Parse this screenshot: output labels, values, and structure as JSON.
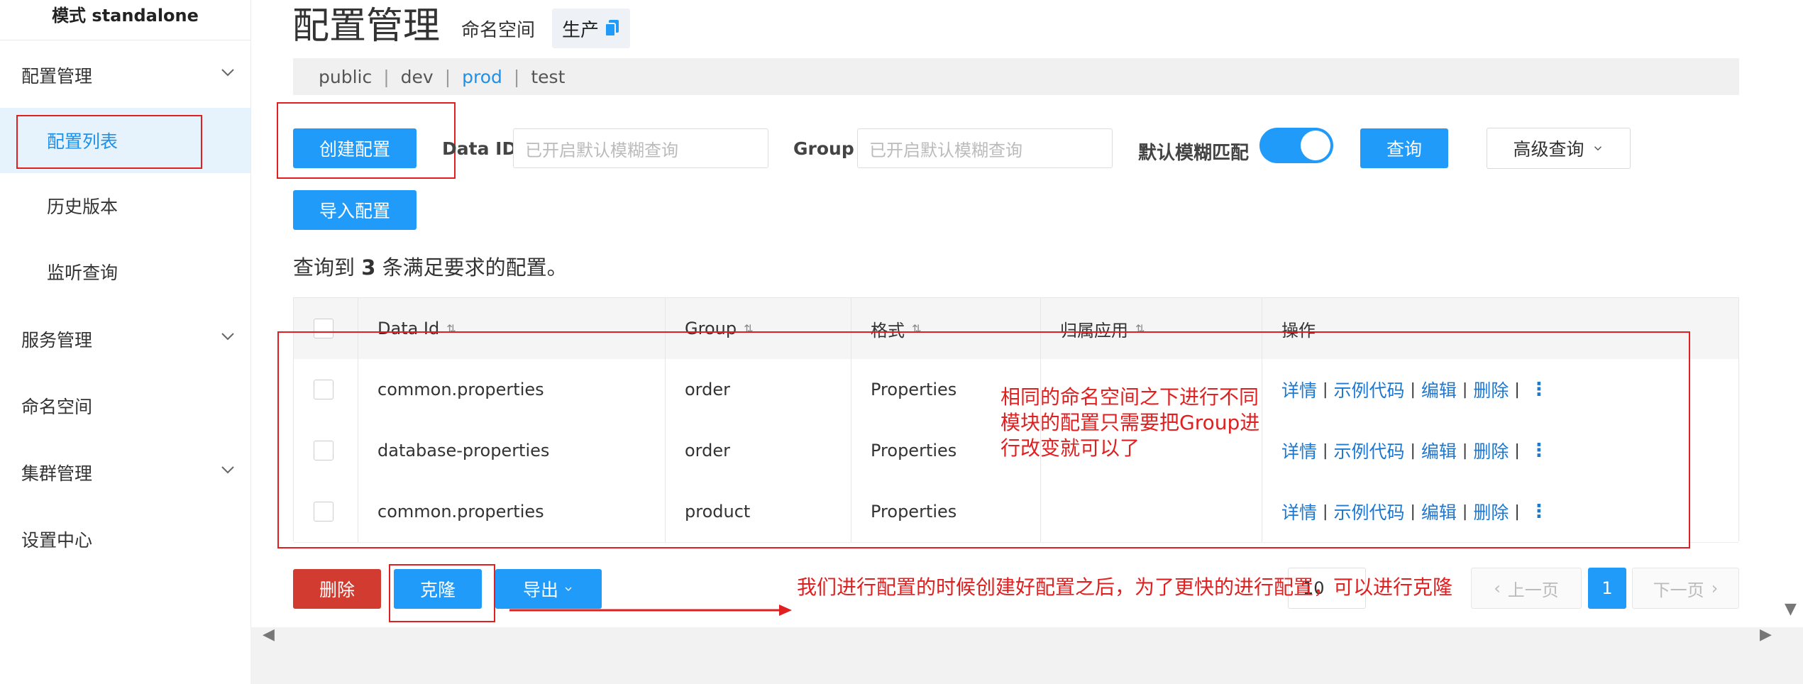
{
  "sidebar": {
    "mode": "模式 standalone",
    "items": [
      {
        "label": "配置管理"
      },
      {
        "label": "配置列表"
      },
      {
        "label": "历史版本"
      },
      {
        "label": "监听查询"
      },
      {
        "label": "服务管理"
      },
      {
        "label": "命名空间"
      },
      {
        "label": "集群管理"
      },
      {
        "label": "设置中心"
      }
    ]
  },
  "header": {
    "title": "配置管理",
    "namespace_label": "命名空间",
    "namespace_value": "生产"
  },
  "namespaces": [
    "public",
    "dev",
    "prod",
    "test"
  ],
  "active_namespace": "prod",
  "toolbar": {
    "create_label": "创建配置",
    "dataid_label": "Data ID",
    "dataid_placeholder": "已开启默认模糊查询",
    "group_label": "Group",
    "group_placeholder": "已开启默认模糊查询",
    "fuzzy_label": "默认模糊匹配",
    "fuzzy_on": true,
    "query_label": "查询",
    "advanced_label": "高级查询",
    "import_label": "导入配置"
  },
  "result": {
    "prefix": "查询到",
    "count": "3",
    "suffix": "条满足要求的配置。"
  },
  "table": {
    "columns": [
      "Data Id",
      "Group",
      "格式",
      "归属应用",
      "操作"
    ],
    "rows": [
      {
        "data_id": "common.properties",
        "group": "order",
        "format": "Properties",
        "app": ""
      },
      {
        "data_id": "database-properties",
        "group": "order",
        "format": "Properties",
        "app": ""
      },
      {
        "data_id": "common.properties",
        "group": "product",
        "format": "Properties",
        "app": ""
      }
    ],
    "ops": [
      "详情",
      "示例代码",
      "编辑",
      "删除"
    ]
  },
  "bottom": {
    "delete_label": "删除",
    "clone_label": "克隆",
    "export_label": "导出",
    "page_size": "10",
    "prev_label": "上一页",
    "next_label": "下一页",
    "current_page": "1"
  },
  "annotations": {
    "note1": "相同的命名空间之下进行不同模块的配置只需要把Group进行改变就可以了",
    "note2": "我们进行配置的时候创建好配置之后，为了更快的进行配置，可以进行克隆"
  },
  "colors": {
    "primary": "#209bfa",
    "danger": "#d23b2f",
    "annotation": "#e02020",
    "link": "#1e78d0"
  }
}
